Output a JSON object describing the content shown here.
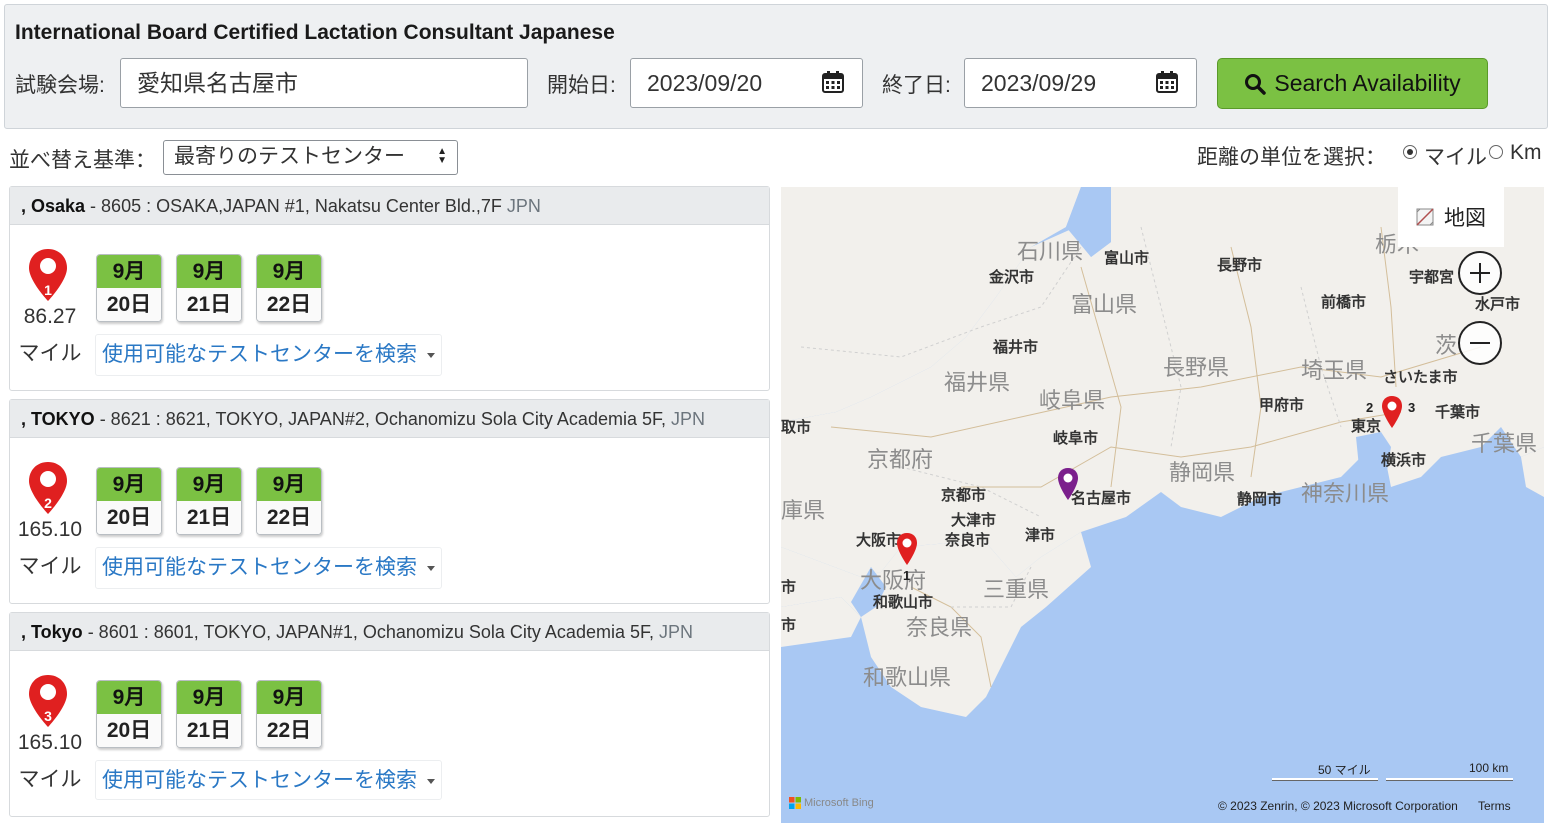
{
  "header": {
    "title": "International Board Certified Lactation Consultant Japanese",
    "venue_label": "試験会場:",
    "venue_value": "愛知県名古屋市",
    "start_label": "開始日:",
    "start_value": "2023/09/20",
    "end_label": "終了日:",
    "end_value": "2023/09/29",
    "search_label": "Search Availability"
  },
  "sort": {
    "label": "並べ替え基準：",
    "selected": "最寄りのテストセンター"
  },
  "units": {
    "label": "距離の単位を選択：",
    "miles": "マイル",
    "km": "Km",
    "selected": "miles"
  },
  "results": [
    {
      "pin_number": "1",
      "city": ", Osaka",
      "detail": " - 8605 : OSAKA,JAPAN #1, Nakatsu Center Bld.,7F ",
      "country": "JPN",
      "distance": "86.27",
      "distance_unit": "マイル",
      "dates": [
        {
          "month": "9月",
          "day": "20日"
        },
        {
          "month": "9月",
          "day": "21日"
        },
        {
          "month": "9月",
          "day": "22日"
        }
      ],
      "find_link": "使用可能なテストセンターを検索"
    },
    {
      "pin_number": "2",
      "city": ", TOKYO",
      "detail": " - 8621 : 8621, TOKYO, JAPAN#2, Ochanomizu Sola City Academia 5F, ",
      "country": "JPN",
      "distance": "165.10",
      "distance_unit": "マイル",
      "dates": [
        {
          "month": "9月",
          "day": "20日"
        },
        {
          "month": "9月",
          "day": "21日"
        },
        {
          "month": "9月",
          "day": "22日"
        }
      ],
      "find_link": "使用可能なテストセンターを検索"
    },
    {
      "pin_number": "3",
      "city": ", Tokyo",
      "detail": " - 8601 : 8601, TOKYO, JAPAN#1, Ochanomizu Sola City Academia 5F, ",
      "country": "JPN",
      "distance": "165.10",
      "distance_unit": "マイル",
      "dates": [
        {
          "month": "9月",
          "day": "20日"
        },
        {
          "month": "9月",
          "day": "21日"
        },
        {
          "month": "9月",
          "day": "22日"
        }
      ],
      "find_link": "使用可能なテストセンターを検索"
    }
  ],
  "map": {
    "type_button": "地図",
    "labels": {
      "ishikawa": "石川県",
      "toyama_pref": "富山県",
      "fukui_pref": "福井県",
      "gifu_pref": "岐阜県",
      "nagano_pref": "長野県",
      "saitama_pref": "埼玉県",
      "kyoto_pref": "京都府",
      "shizuoka_pref": "静岡県",
      "kanagawa_pref": "神奈川県",
      "chiba_pref": "千葉県",
      "osaka_pref": "大阪府",
      "mie_pref": "三重県",
      "nara_pref": "奈良県",
      "wakayama_pref": "和歌山県",
      "tochigi_partial": "栃木",
      "ibaraki_partial": "茨",
      "hyogo_partial": "庫県",
      "toyama_city": "富山市",
      "kanazawa_city": "金沢市",
      "nagano_city": "長野市",
      "utsunomiya_partial": "宇都宮",
      "maebashi_city": "前橋市",
      "mito_city": "水戸市",
      "fukui_city": "福井市",
      "saitama_city": "さいたま市",
      "kofu_city": "甲府市",
      "tokyo_partial": "東京",
      "chiba_city": "千葉市",
      "gifu_city": "岐阜市",
      "yokohama_city": "横浜市",
      "kyoto_city": "京都市",
      "nagoya_city": "名古屋市",
      "otsu_city": "大津市",
      "shizuoka_city": "静岡市",
      "nara_city": "奈良市",
      "tsu_city": "津市",
      "osaka_city": "大阪市",
      "wakayama_city": "和歌山市",
      "edge_city_1": "取市",
      "edge_city_2": "市",
      "edge_city_3": "市"
    },
    "scale_miles": "50 マイル",
    "scale_km": "100 km",
    "copyright": "© 2023 Zenrin, © 2023 Microsoft Corporation",
    "terms": "Terms",
    "bing": "Microsoft Bing"
  },
  "colors": {
    "accent_green": "#7bc143",
    "link_blue": "#2a78c5",
    "pin_red": "#e02020",
    "pin_purple": "#7b1f8c",
    "water": "#a9c8f3",
    "land": "#f2f0ec"
  }
}
